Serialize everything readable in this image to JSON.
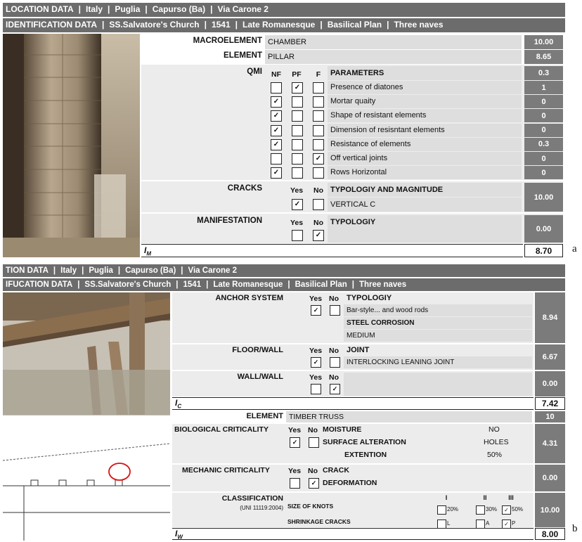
{
  "panel_a": {
    "header1": [
      "LOCATION DATA",
      "Italy",
      "Puglia",
      "Capurso (Ba)",
      "Via Carone 2"
    ],
    "header2": [
      "IDENTIFICATION DATA",
      "SS.Salvatore's Church",
      "1541",
      "Late Romanesque",
      "Basilical Plan",
      "Three naves"
    ],
    "macroelement_label": "MACROELEMENT",
    "macroelement_value": "CHAMBER",
    "macroelement_score": "10.00",
    "element_label": "ELEMENT",
    "element_value": "PILLAR",
    "element_score": "8.65",
    "qmi_label": "QMI",
    "col_nf": "NF",
    "col_pf": "PF",
    "col_f": "F",
    "parameters_label": "PARAMETERS",
    "parameters_score": "0.3",
    "parameters": [
      {
        "name": "Presence of diatones",
        "score": "1",
        "check": "PF"
      },
      {
        "name": "Mortar quaity",
        "score": "0",
        "check": "NF"
      },
      {
        "name": "Shape of resistant elements",
        "score": "0",
        "check": "NF"
      },
      {
        "name": "Dimension of resisntant elements",
        "score": "0",
        "check": "NF"
      },
      {
        "name": "Resistance of elements",
        "score": "0.3",
        "check": "NF"
      },
      {
        "name": "Off vertical joints",
        "score": "0",
        "check": "F"
      },
      {
        "name": "Rows Horizontal",
        "score": "0",
        "check": "NF"
      }
    ],
    "cracks_label": "CRACKS",
    "yes": "Yes",
    "no": "No",
    "typology_magnitude_label": "TYPOLOGIY AND MAGNITUDE",
    "cracks_value": "VERTICAL C",
    "cracks_score": "10.00",
    "manifestation_label": "MANIFESTATION",
    "typology_label": "TYPOLOGIY",
    "manifestation_score": "0.00",
    "index_label": "I",
    "index_sub": "M",
    "index_value": "8.70",
    "panel_letter": "a",
    "check_mark": "✓"
  },
  "panel_b": {
    "header1": [
      "TION DATA",
      "Italy",
      "Puglia",
      "Capurso (Ba)",
      "Via Carone 2"
    ],
    "header2": [
      "IFUCATION DATA",
      "SS.Salvatore's Church",
      "1541",
      "Late Romanesque",
      "Basilical Plan",
      "Three naves"
    ],
    "anchor_label": "ANCHOR SYSTEM",
    "yes": "Yes",
    "no": "No",
    "typology_label": "TYPOLOGIY",
    "anchor_value": "Bar-style... and wood rods",
    "steel_corrosion_label": "STEEL CORROSION",
    "steel_corrosion_value": "MEDIUM",
    "anchor_score": "8.94",
    "floor_wall_label": "FLOOR/WALL",
    "joint_label": "JOINT",
    "joint_value": "INTERLOCKING LEANING JOINT",
    "floor_wall_score": "6.67",
    "wall_wall_label": "WALL/WALL",
    "wall_wall_score": "0.00",
    "ic_label": "I",
    "ic_sub": "C",
    "ic_value": "7.42",
    "element_label": "ELEMENT",
    "element_value": "TIMBER TRUSS",
    "element_score": "10",
    "bio_label": "BIOLOGICAL CRITICALITY",
    "moisture_label": "MOISTURE",
    "moisture_value": "NO",
    "surface_label": "SURFACE ALTERATION",
    "surface_value": "HOLES",
    "extention_label": "EXTENTION",
    "extention_value": "50%",
    "bio_score": "4.31",
    "mech_label": "MECHANIC CRITICALITY",
    "crack_label": "CRACK",
    "deformation_label": "DEFORMATION",
    "mech_score": "0.00",
    "class_label": "CLASSIFICATION",
    "class_norm": "(UNI 11119:2004)",
    "knots_label": "SIZE OF KNOTS",
    "shrink_label": "SHRINKAGE CRACKS",
    "class_cols": [
      "I",
      "II",
      "III"
    ],
    "knots_opts": [
      "20%",
      "30%",
      "50%"
    ],
    "shrink_opts": [
      "L",
      "A",
      "P"
    ],
    "class_score": "10.00",
    "iw_label": "I",
    "iw_sub": "W",
    "iw_value": "8.00",
    "panel_letter": "b",
    "check_mark": "✓"
  }
}
